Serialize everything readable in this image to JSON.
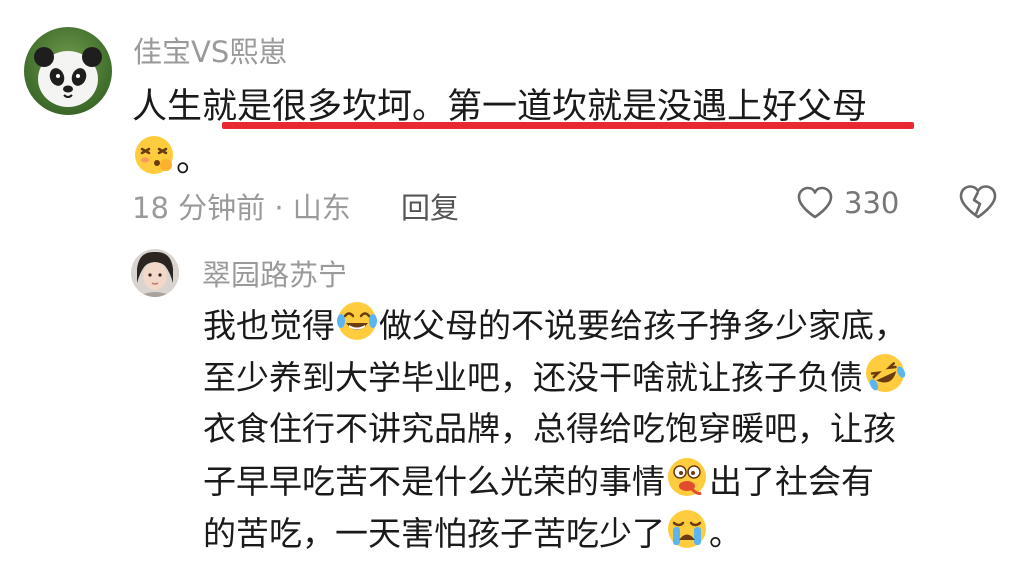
{
  "comment": {
    "username": "佳宝VS熙崽",
    "text_line1": "人生就是很多坎坷。第一道坎就是没遇上好父母",
    "text_line2_suffix": "。",
    "time_location": "18 分钟前 · 山东",
    "reply_label": "回复",
    "like_count": "330",
    "avatar_icon": "panda-avatar",
    "emoji_icon": "dizzy-face-emoji",
    "highlight_color": "#e8292f"
  },
  "reply": {
    "username": "翠园路苏宁",
    "avatar_icon": "user-portrait-avatar",
    "lines": [
      "我也觉得",
      "做父母的不说要给孩子挣多少家底，",
      "至少养到大学毕业吧，还没干啥就让孩子负债",
      "衣食住行不讲究品牌，总得给吃饱穿暖吧，让孩",
      "子早早吃苦不是什么光荣的事情",
      "出了社会有",
      "的苦吃，一天害怕孩子苦吃少了",
      "。"
    ],
    "emojis": [
      "tears-of-joy-emoji",
      "rolling-laughing-emoji",
      "vomiting-face-emoji",
      "loudly-crying-emoji"
    ]
  }
}
